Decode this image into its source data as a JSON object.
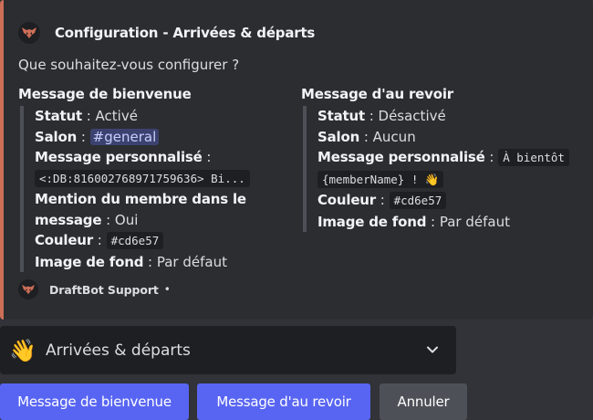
{
  "embed": {
    "accent_color": "#cd6e57",
    "author": "Configuration - Arrivées & départs",
    "description": "Que souhaitez-vous configurer ?",
    "fields": [
      {
        "title": "Message de bienvenue",
        "statut_label": "Statut",
        "statut_value": ": Activé",
        "salon_label": "Salon",
        "salon_value": "general",
        "message_label": "Message personnalisé",
        "message_value": "<:DB:816002768971759636> Bi...",
        "mention_label_1": "Mention du membre dans le",
        "mention_label_2": "message",
        "mention_value": ": Oui",
        "couleur_label": "Couleur",
        "couleur_value": "#cd6e57",
        "fond_label": "Image de fond",
        "fond_value": ": Par défaut"
      },
      {
        "title": "Message d'au revoir",
        "statut_label": "Statut",
        "statut_value": ": Désactivé",
        "salon_label": "Salon",
        "salon_value": ": Aucun",
        "message_label": "Message personnalisé",
        "message_value_1": "À bientôt",
        "message_value_2": "{memberName} ! 👋",
        "couleur_label": "Couleur",
        "couleur_value": "#cd6e57",
        "fond_label": "Image de fond",
        "fond_value": ": Par défaut"
      }
    ],
    "footer": "DraftBot Support",
    "footer_sep": "•"
  },
  "select": {
    "emoji": "👋",
    "label": "Arrivées & départs"
  },
  "buttons": {
    "welcome": "Message de bienvenue",
    "goodbye": "Message d'au revoir",
    "cancel": "Annuler"
  }
}
